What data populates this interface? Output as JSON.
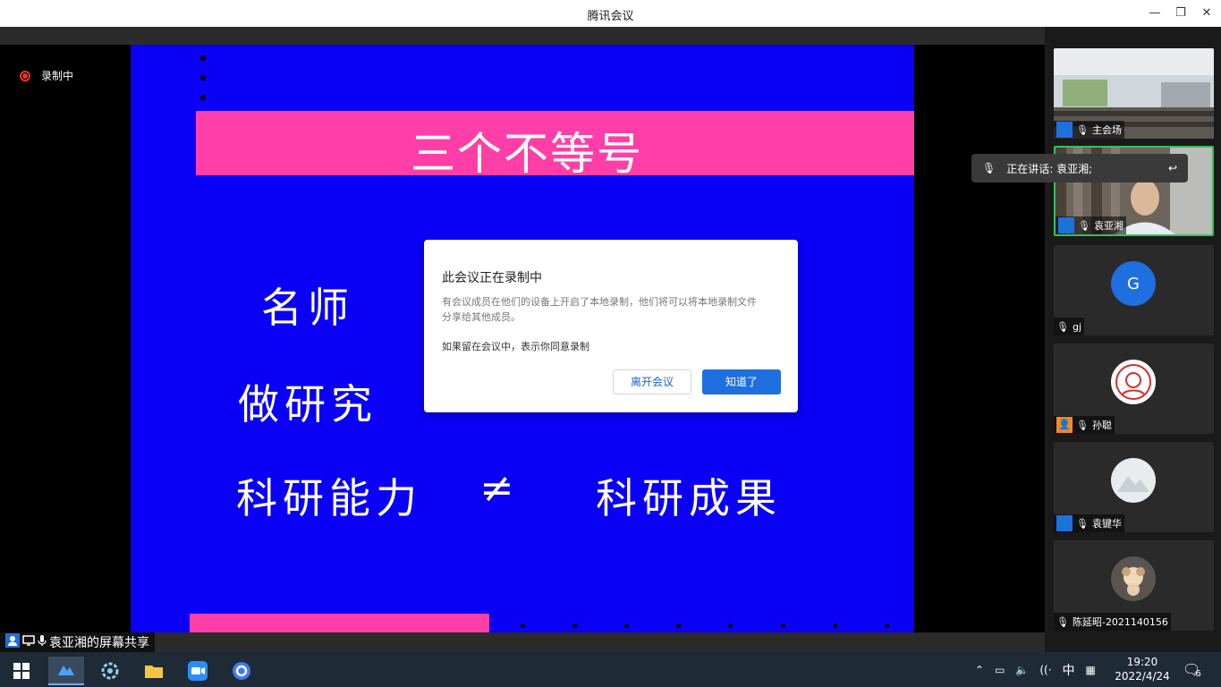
{
  "window": {
    "title": "腾讯会议"
  },
  "recording": {
    "label": "录制中"
  },
  "slide": {
    "title": "三个不等号",
    "line1": "名师",
    "line2": "做研究",
    "line3_left": "科研能力",
    "line3_symbol": "≠",
    "line3_right": "科研成果"
  },
  "dialog": {
    "title": "此会议正在录制中",
    "body": "有会议成员在他们的设备上开启了本地录制，他们将可以将本地录制文件分享给其他成员。",
    "consent": "如果留在会议中，表示你同意录制",
    "leave_button": "离开会议",
    "ok_button": "知道了"
  },
  "share": {
    "label": "袁亚湘的屏幕共享"
  },
  "speaking": {
    "label": "正在讲话: 袁亚湘;"
  },
  "participants": [
    {
      "name": "主会场",
      "badge": "blue"
    },
    {
      "name": "袁亚湘",
      "badge": "blue"
    },
    {
      "name": "gj",
      "initial": "G"
    },
    {
      "name": "孙聪",
      "badge": "orange"
    },
    {
      "name": "袁键华",
      "badge": "blue"
    },
    {
      "name": "陈延昭-2021140156"
    }
  ],
  "taskbar": {
    "ime": "中",
    "time": "19:20",
    "date": "2022/4/24",
    "notifications": "6"
  },
  "colors": {
    "slide_bg": "#0a00f5",
    "slide_pink": "#ff3fa7",
    "accent": "#1e6fe0",
    "rec": "#e53935"
  }
}
